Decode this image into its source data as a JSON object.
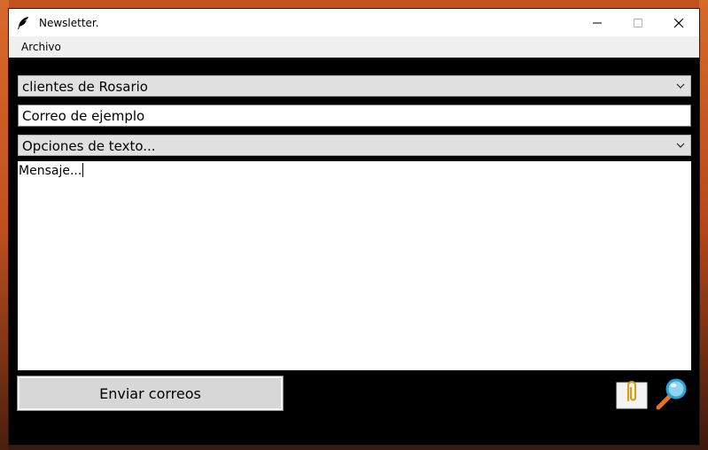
{
  "window": {
    "title": "Newsletter.",
    "icon": "feather-icon",
    "controls": [
      "minimize-icon",
      "maximize-icon",
      "close-icon"
    ]
  },
  "menu": {
    "items": [
      {
        "label": "Archivo"
      }
    ]
  },
  "form": {
    "recipients_select": {
      "value": "clientes de Rosario"
    },
    "subject_field": {
      "value": "Correo de ejemplo"
    },
    "text_options_select": {
      "value": "Opciones de texto..."
    },
    "message": {
      "value": "Mensaje..."
    }
  },
  "actions": {
    "send_label": "Enviar correos",
    "attach_icon": "paperclip-icon",
    "preview_icon": "magnifier-icon"
  },
  "colors": {
    "window_bg": "#000000",
    "titlebar_bg": "#ffffff",
    "menubar_bg": "#f0f0f0",
    "combo_bg": "#e1e1e1",
    "button_bg": "#d7d7d7",
    "accent_magnifier": "#29a3d6",
    "handle_orange": "#e8711e"
  }
}
